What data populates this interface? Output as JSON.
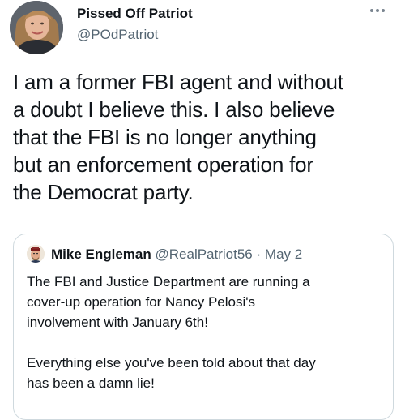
{
  "tweet": {
    "display_name": "Pissed Off Patriot",
    "handle": "@POdPatriot",
    "text_lines": [
      "I am a former FBI agent and without",
      "a doubt I believe this. I also believe",
      "that the FBI is no longer anything",
      "but an enforcement operation for",
      "the Democrat party."
    ],
    "more_icon": "more-horizontal-icon"
  },
  "quoted_tweet": {
    "display_name": "Mike Engleman",
    "handle": "@RealPatriot56",
    "separator": "·",
    "date": "May 2",
    "paragraph1_lines": [
      "The FBI and Justice Department are running a",
      "cover-up operation for Nancy Pelosi's",
      "involvement with January 6th!"
    ],
    "paragraph2_lines": [
      "Everything else you've been told about that day",
      "has been a damn lie!"
    ]
  },
  "colors": {
    "text_primary": "#0f1419",
    "text_secondary": "#536471",
    "border": "#cfd9de"
  }
}
